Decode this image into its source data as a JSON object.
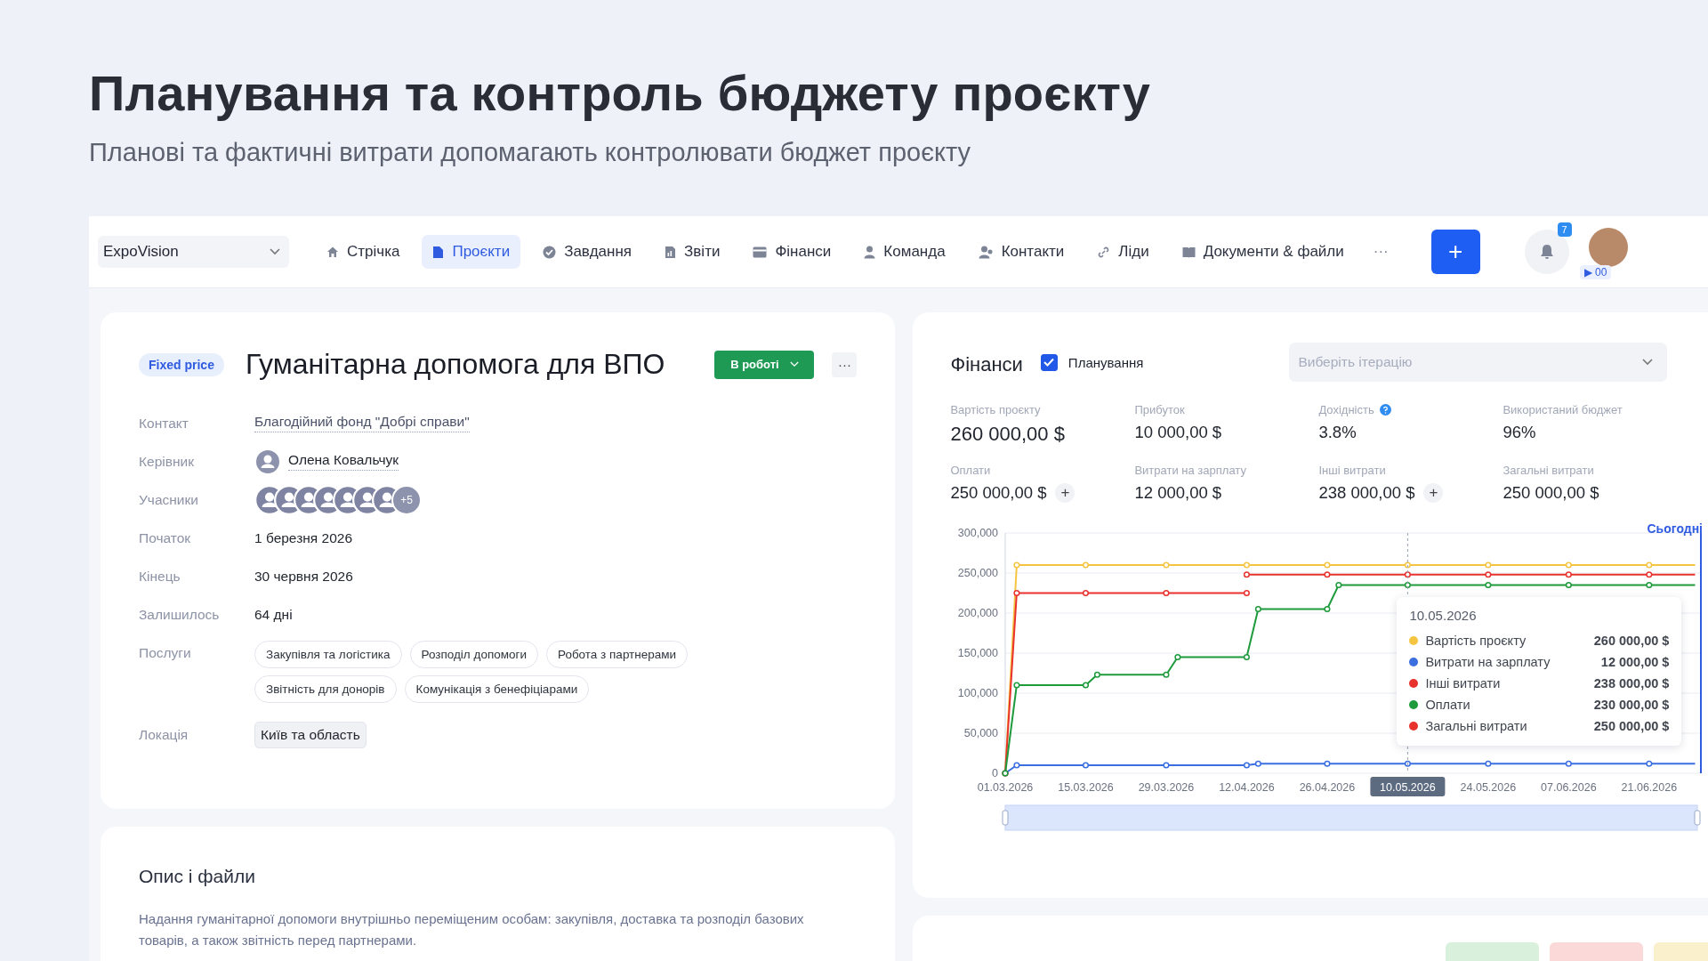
{
  "heading": {
    "title": "Планування та контроль бюджету проєкту",
    "subtitle": "Планові та фактичні витрати допомагають контролювати бюджет проєкту"
  },
  "navbar": {
    "project_select": "ExpoVision",
    "items": [
      {
        "label": "Стрічка",
        "selected": false
      },
      {
        "label": "Проєкти",
        "selected": true
      },
      {
        "label": "Завдання",
        "selected": false
      },
      {
        "label": "Звіти",
        "selected": false
      },
      {
        "label": "Фінанси",
        "selected": false
      },
      {
        "label": "Команда",
        "selected": false
      },
      {
        "label": "Контакти",
        "selected": false
      },
      {
        "label": "Ліди",
        "selected": false
      },
      {
        "label": "Документи & файли",
        "selected": false
      }
    ],
    "more": "···",
    "add_button": "+",
    "notifications_badge": "7",
    "timer": "▶ 00"
  },
  "project": {
    "badge": "Fixed price",
    "title": "Гуманітарна допомога для ВПО",
    "status": "В роботі",
    "menu": "···",
    "fields": [
      {
        "kind": "link",
        "label": "Контакт",
        "value": "Благодійний фонд \"Добрі справи\""
      },
      {
        "kind": "person",
        "label": "Керівник",
        "value": "Олена Ковальчук"
      },
      {
        "kind": "avatars",
        "label": "Учасники",
        "more": "+5"
      },
      {
        "kind": "text",
        "label": "Початок",
        "value": "1 березня 2026"
      },
      {
        "kind": "text",
        "label": "Кінець",
        "value": "30 червня 2026"
      },
      {
        "kind": "text",
        "label": "Залишилось",
        "value": "64 дні"
      },
      {
        "kind": "chips",
        "label": "Послуги",
        "chips": [
          "Закупівля та логістика",
          "Розподіл допомоги",
          "Робота з партнерами",
          "Звітність для донорів",
          "Комунікація з бенефіціарами"
        ]
      },
      {
        "kind": "tag",
        "label": "Локація",
        "value": "Київ та область"
      }
    ]
  },
  "description": {
    "title": "Опис і файли",
    "text": "Надання гуманітарної допомоги внутрішньо переміщеним особам: закупівля, доставка та розподіл базових товарів, а також звітність перед партнерами."
  },
  "finance": {
    "title": "Фінанси",
    "planning": {
      "label": "Планування",
      "checked": true
    },
    "iteration_select": {
      "placeholder": "Виберіть ітерацію"
    },
    "metrics": [
      {
        "label": "Вартість проєкту",
        "value": "260 000,00 $",
        "kind": "large"
      },
      {
        "label": "Прибуток",
        "value": "10 000,00 $",
        "kind": "plain"
      },
      {
        "label": "Дохідність",
        "value": "3.8%",
        "kind": "help"
      },
      {
        "label": "Використаний бюджет",
        "value": "96%",
        "kind": "plain"
      },
      {
        "label": "Оплати",
        "value": "250 000,00 $",
        "kind": "add",
        "action": "+"
      },
      {
        "label": "Витрати на зарплату",
        "value": "12 000,00 $",
        "kind": "plain"
      },
      {
        "label": "Інші витрати",
        "value": "238 000,00 $",
        "kind": "add",
        "action": "+"
      },
      {
        "label": "Загальні витрати",
        "value": "250 000,00 $",
        "kind": "plain"
      }
    ],
    "today_label": "Сьогодні",
    "chart_data": {
      "type": "line",
      "grid": true,
      "categories": [
        "01.03.2026",
        null,
        null,
        null,
        null,
        null,
        null,
        "15.03.2026",
        null,
        null,
        null,
        null,
        null,
        null,
        "29.03.2026",
        null,
        null,
        null,
        null,
        null,
        null,
        "12.04.2026",
        null,
        null,
        null,
        null,
        null,
        null,
        "26.04.2026",
        null,
        null,
        null,
        null,
        null,
        null,
        "10.05.2026",
        null,
        null,
        null,
        null,
        null,
        null,
        "24.05.2026",
        null,
        null,
        null,
        null,
        null,
        null,
        "07.06.2026",
        null,
        null,
        null,
        null,
        null,
        null,
        "21.06.2026",
        null,
        null,
        null,
        null
      ],
      "series": [
        {
          "name": "Вартість проєкту",
          "color": "#f5c542",
          "values": [
            0,
            260000,
            260000,
            260000,
            260000,
            260000,
            260000,
            260000,
            260000,
            260000,
            260000,
            260000,
            260000,
            260000,
            260000,
            260000,
            260000,
            260000,
            260000,
            260000,
            260000,
            260000,
            260000,
            260000,
            260000,
            260000,
            260000,
            260000,
            260000,
            260000,
            260000,
            260000,
            260000,
            260000,
            260000,
            260000,
            260000,
            260000,
            260000,
            260000,
            260000,
            260000,
            260000,
            260000,
            260000,
            260000,
            260000,
            260000,
            260000,
            260000,
            260000,
            260000,
            260000,
            260000,
            260000,
            260000,
            260000,
            260000,
            260000,
            260000,
            260000
          ]
        },
        {
          "name": "Витрати на зарплату",
          "color": "#3b6fe0",
          "values": [
            0,
            10000,
            10000,
            10000,
            10000,
            10000,
            10000,
            10000,
            10000,
            10000,
            10000,
            10000,
            10000,
            10000,
            10000,
            10000,
            10000,
            10000,
            10000,
            10000,
            10000,
            10000,
            12000,
            12000,
            12000,
            12000,
            12000,
            12000,
            12000,
            12000,
            12000,
            12000,
            12000,
            12000,
            12000,
            12000,
            12000,
            12000,
            12000,
            12000,
            12000,
            12000,
            12000,
            12000,
            12000,
            12000,
            12000,
            12000,
            12000,
            12000,
            12000,
            12000,
            12000,
            12000,
            12000,
            12000,
            12000,
            12000,
            12000,
            12000,
            12000
          ]
        },
        {
          "name": "Інші витрати",
          "color": "#e8322e",
          "values": [
            0,
            225000,
            225000,
            225000,
            225000,
            225000,
            225000,
            225000,
            225000,
            225000,
            225000,
            225000,
            225000,
            225000,
            225000,
            225000,
            225000,
            225000,
            225000,
            225000,
            225000,
            225000,
            null,
            null,
            null,
            null,
            null,
            null,
            null,
            null,
            null,
            null,
            null,
            null,
            null,
            null,
            null,
            null,
            null,
            null,
            null,
            null,
            null,
            null,
            null,
            null,
            null,
            null,
            null,
            null,
            null,
            null,
            null,
            null,
            null,
            null,
            null,
            null,
            null,
            null,
            null
          ]
        },
        {
          "name": "Оплати",
          "color": "#1f9a3c",
          "values": [
            0,
            110000,
            110000,
            110000,
            110000,
            110000,
            110000,
            110000,
            123000,
            123000,
            123000,
            123000,
            123000,
            123000,
            123000,
            145000,
            145000,
            145000,
            145000,
            145000,
            145000,
            145000,
            205000,
            205000,
            205000,
            205000,
            205000,
            205000,
            205000,
            235000,
            235000,
            235000,
            235000,
            235000,
            235000,
            235000,
            235000,
            235000,
            235000,
            235000,
            235000,
            235000,
            235000,
            235000,
            235000,
            235000,
            235000,
            235000,
            235000,
            235000,
            235000,
            235000,
            235000,
            235000,
            235000,
            235000,
            235000,
            235000,
            235000,
            235000,
            235000
          ]
        },
        {
          "name": "Загальні витрати",
          "color": "#e8322e",
          "values": [
            null,
            null,
            null,
            null,
            null,
            null,
            null,
            null,
            null,
            null,
            null,
            null,
            null,
            null,
            null,
            null,
            null,
            null,
            null,
            null,
            null,
            248000,
            248000,
            248000,
            248000,
            248000,
            248000,
            248000,
            248000,
            248000,
            248000,
            248000,
            248000,
            248000,
            248000,
            248000,
            248000,
            248000,
            248000,
            248000,
            248000,
            248000,
            248000,
            248000,
            248000,
            248000,
            248000,
            248000,
            248000,
            248000,
            248000,
            248000,
            248000,
            248000,
            248000,
            248000,
            248000,
            248000,
            248000,
            248000,
            248000
          ]
        }
      ],
      "ylim": [
        0,
        300000
      ],
      "yticks": [
        {
          "value": 0,
          "label": "0"
        },
        {
          "value": 50000,
          "label": "50,000"
        },
        {
          "value": 100000,
          "label": "100,000"
        },
        {
          "value": 150000,
          "label": "150,000"
        },
        {
          "value": 200000,
          "label": "200,000"
        },
        {
          "value": 250000,
          "label": "250,000"
        },
        {
          "value": 300000,
          "label": "300,000"
        }
      ],
      "annotations": [
        {
          "x": "10.05.2026"
        }
      ]
    },
    "tooltip": {
      "title": "10.05.2026",
      "values": [
        "260 000,00 $",
        "12 000,00 $",
        "238 000,00 $",
        "230 000,00 $",
        "250 000,00 $"
      ]
    }
  },
  "lower_panel": {
    "chips": [
      {
        "color": "#d9f0dc"
      },
      {
        "color": "#fbd9d9"
      },
      {
        "color": "#faf0cc"
      }
    ]
  }
}
